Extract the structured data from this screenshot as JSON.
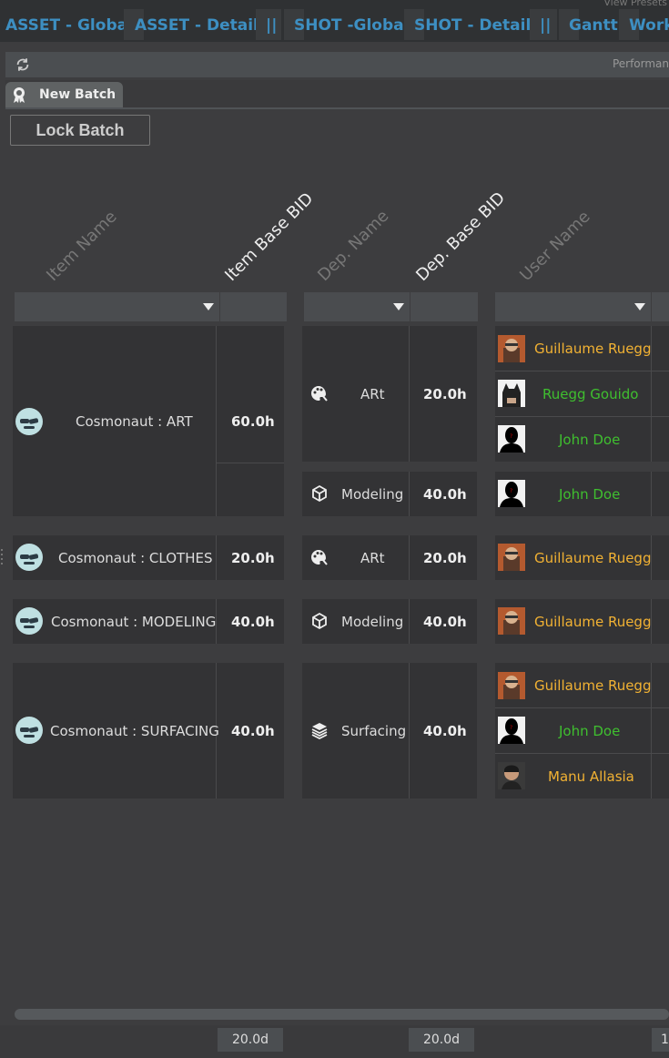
{
  "view_presets": "View Presets",
  "presets": [
    {
      "label": "ASSET - Global"
    },
    {
      "label": "ASSET - Details"
    },
    {
      "label": "||"
    },
    {
      "label": "SHOT -Global"
    },
    {
      "label": "SHOT - Details"
    },
    {
      "label": "||"
    },
    {
      "label": "Gantt"
    },
    {
      "label": "Work"
    }
  ],
  "toolbar": {
    "perf_label": "Performan"
  },
  "tab": {
    "label": "New Batch"
  },
  "lock_batch_label": "Lock Batch",
  "columns": {
    "item_name": "Item Name",
    "item_base_bid": "Item Base BID",
    "dep_name": "Dep. Name",
    "dep_base_bid": "Dep. Base BID",
    "user_name": "User Name"
  },
  "rows": [
    {
      "item": "Cosmonaut : ART",
      "item_bid": "60.0h",
      "deps": [
        {
          "name": "ARt",
          "bid": "20.0h",
          "icon": "palette-icon",
          "users": [
            {
              "name": "Guillaume Ruegg",
              "avatar": "guillaume",
              "color": "yellow"
            },
            {
              "name": "Ruegg Gouido",
              "avatar": "batman",
              "color": "green"
            },
            {
              "name": "John Doe",
              "avatar": "johndoe",
              "color": "green"
            }
          ]
        },
        {
          "name": "Modeling",
          "bid": "40.0h",
          "icon": "cube-icon",
          "users": [
            {
              "name": "John Doe",
              "avatar": "johndoe",
              "color": "green"
            }
          ]
        }
      ]
    },
    {
      "item": "Cosmonaut : CLOTHES",
      "item_bid": "20.0h",
      "deps": [
        {
          "name": "ARt",
          "bid": "20.0h",
          "icon": "palette-icon",
          "users": [
            {
              "name": "Guillaume Ruegg",
              "avatar": "guillaume",
              "color": "yellow"
            }
          ]
        }
      ]
    },
    {
      "item": "Cosmonaut : MODELING",
      "item_bid": "40.0h",
      "deps": [
        {
          "name": "Modeling",
          "bid": "40.0h",
          "icon": "cube-icon",
          "users": [
            {
              "name": "Guillaume Ruegg",
              "avatar": "guillaume",
              "color": "yellow"
            }
          ]
        }
      ]
    },
    {
      "item": "Cosmonaut : SURFACING",
      "item_bid": "40.0h",
      "deps": [
        {
          "name": "Surfacing",
          "bid": "40.0h",
          "icon": "layers-icon",
          "users": [
            {
              "name": "Guillaume Ruegg",
              "avatar": "guillaume",
              "color": "yellow"
            },
            {
              "name": "John Doe",
              "avatar": "johndoe",
              "color": "green"
            },
            {
              "name": "Manu Allasia",
              "avatar": "manu",
              "color": "yellow"
            }
          ]
        }
      ]
    }
  ],
  "totals": {
    "item_bid": "20.0d",
    "dep_bid": "20.0d",
    "user": "1"
  },
  "colors": {
    "preset": "#3d8fc2",
    "yellow_user": "#f2b233",
    "green_user": "#3fbf2f"
  }
}
